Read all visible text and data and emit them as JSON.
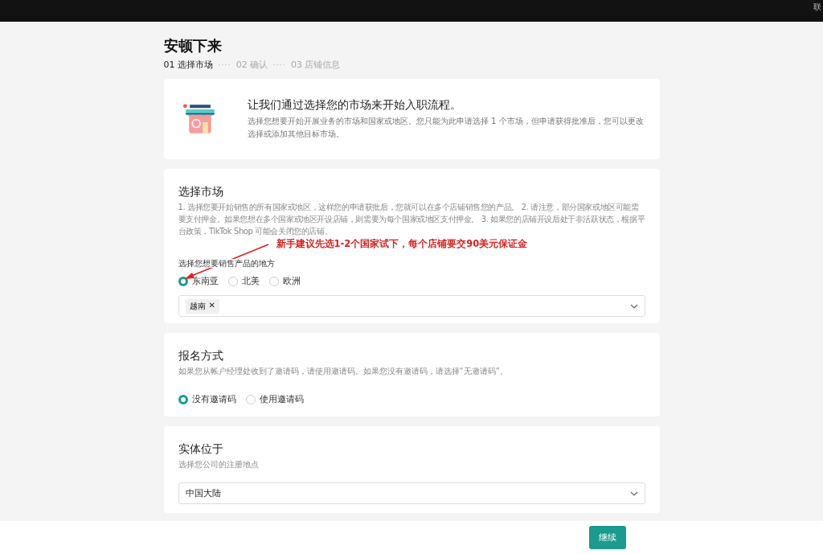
{
  "top_bar": {
    "link": "联"
  },
  "page": {
    "title": "安顿下来",
    "separator": "····",
    "steps": [
      {
        "label": "01 选择市场",
        "selected": true
      },
      {
        "label": "02 确认",
        "selected": false
      },
      {
        "label": "03 店铺信息",
        "selected": false
      }
    ]
  },
  "intro": {
    "heading": "让我们通过选择您的市场来开始入职流程。",
    "text": "选择您想要开始开展业务的市场和国家或地区。您只能为此申请选择 1 个市场，但申请获得批准后，您可以更改选择或添加其他目标市场。"
  },
  "market": {
    "heading": "选择市场",
    "text": "1. 选择您要开始销售的所有国家或地区，这样您的申请获批后，您就可以在多个店铺销售您的产品。 2. 请注意，部分国家或地区可能需要支付押金。如果您想在多个国家或地区开设店铺，则需要为每个国家或地区支付押金。 3. 如果您的店铺开设后处于非活跃状态，根据平台政策，TikTok Shop 可能会关闭您的店铺。",
    "annotation": "新手建议先选1-2个国家试下，每个店铺要交90美元保证金",
    "label": "选择您想要销售产品的地方",
    "options": [
      {
        "label": "东南亚",
        "selected": true
      },
      {
        "label": "北美",
        "selected": false
      },
      {
        "label": "欧洲",
        "selected": false
      }
    ],
    "tags": [
      {
        "label": "越南",
        "remove": "✕"
      }
    ]
  },
  "signup": {
    "heading": "报名方式",
    "text": "如果您从帐户经理处收到了邀请码，请使用邀请码。如果您没有邀请码，请选择“无邀请码”。",
    "options": [
      {
        "label": "没有邀请码",
        "selected": true
      },
      {
        "label": "使用邀请码",
        "selected": false
      }
    ]
  },
  "entity": {
    "heading": "实体位于",
    "text": "选择您公司的注册地点",
    "value": "中国大陆"
  },
  "footer": {
    "button": "继续"
  }
}
